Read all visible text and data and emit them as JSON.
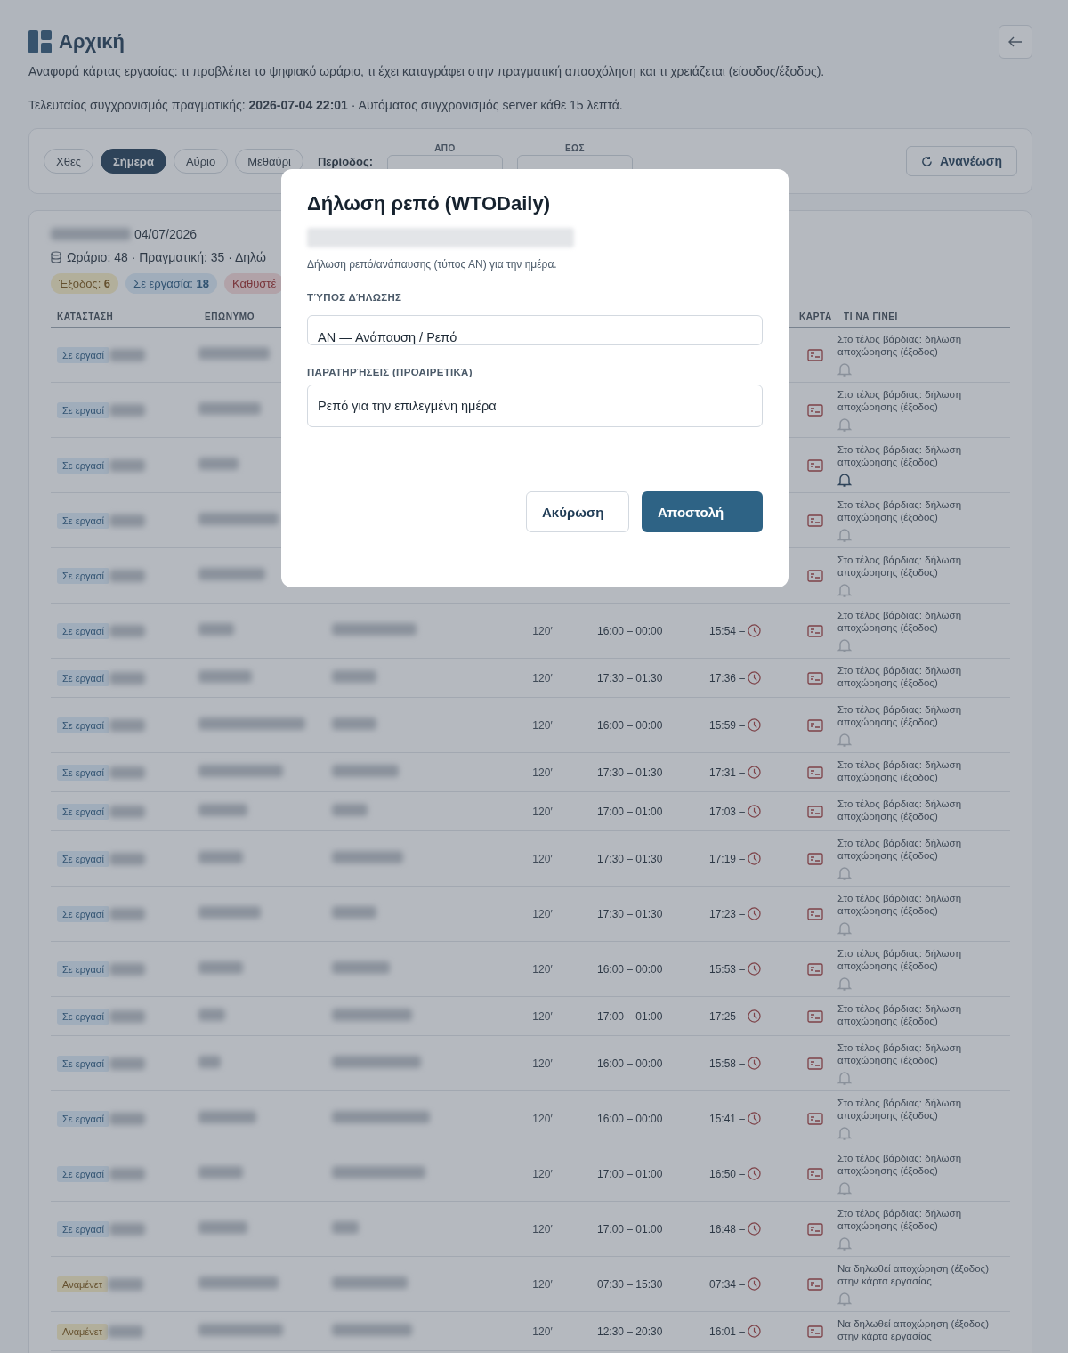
{
  "header": {
    "title": "Αρχική",
    "description": "Αναφορά κάρτας εργασίας: τι προβλέπει το ψηφιακό ωράριο, τι έχει καταγράφει στην πραγματική απασχόληση και τι χρειάζεται (είσοδος/έξοδος).",
    "sync": "Τελευταίος συγχρονισμός πραγματικής: **2026-07-04 22:01** · Αυτόματος συγχρονισμός server κάθε 15 λεπτά."
  },
  "filters": {
    "days": [
      {
        "label": "Χθες",
        "selected": false
      },
      {
        "label": "Σήμερα",
        "selected": true
      },
      {
        "label": "Αύριο",
        "selected": false
      },
      {
        "label": "Μεθαύρι",
        "selected": false
      }
    ],
    "period_label": "Περίοδος:",
    "from_label": "ΑΠΟ",
    "to_label": "ΕΩΣ",
    "refresh": "Ανανέωση"
  },
  "report": {
    "date": "04/07/2026",
    "summary": "Ωράριο: 48 · Πραγματική: 35 · Δηλώ",
    "chips": [
      {
        "kind": "exit",
        "text": "Έξοδος: **6**"
      },
      {
        "kind": "working",
        "text": "Σε εργασία: **18**"
      },
      {
        "kind": "late",
        "text": "Καθυστέ"
      }
    ],
    "columns": {
      "status": "ΚΑΤΑΣΤΑΣΗ",
      "surname": "ΕΠΩΝΥΜΟ",
      "card": "ΚΑΡΤΑ",
      "todo": "ΤΙ ΝΑ ΓΙΝΕΙ"
    },
    "rows": [
      {
        "status": "Σε εργασί",
        "kind": "working",
        "todo": "Στο τέλος βάρδιας: δήλωση αποχώρησης (έξοδος)",
        "reminder": true,
        "reminder_active": false
      },
      {
        "status": "Σε εργασί",
        "kind": "working",
        "todo": "Στο τέλος βάρδιας: δήλωση αποχώρησης (έξοδος)",
        "reminder": true,
        "reminder_active": false
      },
      {
        "status": "Σε εργασί",
        "kind": "working",
        "todo": "Στο τέλος βάρδιας: δήλωση αποχώρησης (έξοδος)",
        "reminder": true,
        "reminder_active": true
      },
      {
        "status": "Σε εργασί",
        "kind": "working",
        "todo": "Στο τέλος βάρδιας: δήλωση αποχώρησης (έξοδος)",
        "reminder": true,
        "reminder_active": false
      },
      {
        "status": "Σε εργασί",
        "kind": "working",
        "todo": "Στο τέλος βάρδιας: δήλωση αποχώρησης (έξοδος)",
        "reminder": true,
        "reminder_active": false
      },
      {
        "status": "Σε εργασί",
        "kind": "working",
        "break": "120′",
        "shift": "16:00 – 00:00",
        "actual": "15:54 –",
        "todo": "Στο τέλος βάρδιας: δήλωση αποχώρησης (έξοδος)",
        "reminder": true,
        "reminder_active": false
      },
      {
        "status": "Σε εργασί",
        "kind": "working",
        "break": "120′",
        "shift": "17:30 – 01:30",
        "actual": "17:36 –",
        "todo": "Στο τέλος βάρδιας: δήλωση αποχώρησης (έξοδος)",
        "reminder": false
      },
      {
        "status": "Σε εργασί",
        "kind": "working",
        "break": "120′",
        "shift": "16:00 – 00:00",
        "actual": "15:59 –",
        "todo": "Στο τέλος βάρδιας: δήλωση αποχώρησης (έξοδος)",
        "reminder": true,
        "reminder_active": false
      },
      {
        "status": "Σε εργασί",
        "kind": "working",
        "break": "120′",
        "shift": "17:30 – 01:30",
        "actual": "17:31 –",
        "todo": "Στο τέλος βάρδιας: δήλωση αποχώρησης (έξοδος)",
        "reminder": false
      },
      {
        "status": "Σε εργασί",
        "kind": "working",
        "break": "120′",
        "shift": "17:00 – 01:00",
        "actual": "17:03 –",
        "todo": "Στο τέλος βάρδιας: δήλωση αποχώρησης (έξοδος)",
        "reminder": false
      },
      {
        "status": "Σε εργασί",
        "kind": "working",
        "break": "120′",
        "shift": "17:30 – 01:30",
        "actual": "17:19 –",
        "todo": "Στο τέλος βάρδιας: δήλωση αποχώρησης (έξοδος)",
        "reminder": true,
        "reminder_active": false
      },
      {
        "status": "Σε εργασί",
        "kind": "working",
        "break": "120′",
        "shift": "17:30 – 01:30",
        "actual": "17:23 –",
        "todo": "Στο τέλος βάρδιας: δήλωση αποχώρησης (έξοδος)",
        "reminder": true,
        "reminder_active": false
      },
      {
        "status": "Σε εργασί",
        "kind": "working",
        "break": "120′",
        "shift": "16:00 – 00:00",
        "actual": "15:53 –",
        "todo": "Στο τέλος βάρδιας: δήλωση αποχώρησης (έξοδος)",
        "reminder": true,
        "reminder_active": false
      },
      {
        "status": "Σε εργασί",
        "kind": "working",
        "break": "120′",
        "shift": "17:00 – 01:00",
        "actual": "17:25 –",
        "todo": "Στο τέλος βάρδιας: δήλωση αποχώρησης (έξοδος)",
        "reminder": false
      },
      {
        "status": "Σε εργασί",
        "kind": "working",
        "break": "120′",
        "shift": "16:00 – 00:00",
        "actual": "15:58 –",
        "todo": "Στο τέλος βάρδιας: δήλωση αποχώρησης (έξοδος)",
        "reminder": true,
        "reminder_active": false
      },
      {
        "status": "Σε εργασί",
        "kind": "working",
        "break": "120′",
        "shift": "16:00 – 00:00",
        "actual": "15:41 –",
        "todo": "Στο τέλος βάρδιας: δήλωση αποχώρησης (έξοδος)",
        "reminder": true,
        "reminder_active": false
      },
      {
        "status": "Σε εργασί",
        "kind": "working",
        "break": "120′",
        "shift": "17:00 – 01:00",
        "actual": "16:50 –",
        "todo": "Στο τέλος βάρδιας: δήλωση αποχώρησης (έξοδος)",
        "reminder": true,
        "reminder_active": false
      },
      {
        "status": "Σε εργασί",
        "kind": "working",
        "break": "120′",
        "shift": "17:00 – 01:00",
        "actual": "16:48 –",
        "todo": "Στο τέλος βάρδιας: δήλωση αποχώρησης (έξοδος)",
        "reminder": true,
        "reminder_active": false
      },
      {
        "status": "Αναμένετ",
        "kind": "waiting",
        "break": "120′",
        "shift": "07:30 – 15:30",
        "actual": "07:34 –",
        "todo": "Να δηλωθεί αποχώρηση (έξοδος) στην κάρτα εργασίας",
        "reminder": true,
        "reminder_active": false
      },
      {
        "status": "Αναμένετ",
        "kind": "waiting",
        "break": "120′",
        "shift": "12:30 – 20:30",
        "actual": "16:01 –",
        "todo": "Να δηλωθεί αποχώρηση (έξοδος) στην κάρτα εργασίας",
        "reminder": false
      }
    ]
  },
  "dialog": {
    "title": "Δήλωση ρεπό (WTODaily)",
    "description": "Δήλωση ρεπό/ανάπαυσης (τύπος ΑΝ) για την ημέρα.",
    "type_label": "ΤΎΠΟΣ ΔΉΛΩΣΗΣ",
    "type_value": "ΑΝ — Ανάπαυση / Ρεπό",
    "notes_label": "ΠΑΡΑΤΗΡΉΣΕΙΣ (ΠΡΟΑΙΡΕΤΙΚΆ)",
    "notes_value": "Ρεπό για την επιλεγμένη ημέρα",
    "cancel": "Ακύρωση",
    "submit": "Αποστολή"
  }
}
